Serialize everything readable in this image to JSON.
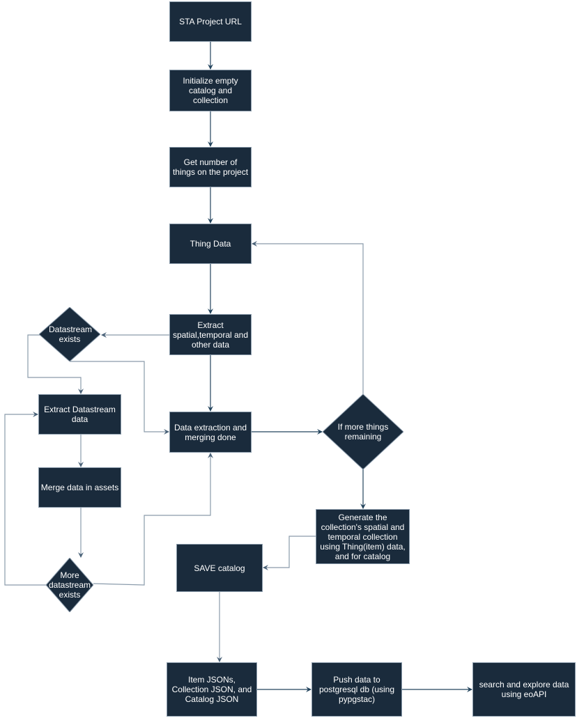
{
  "colors": {
    "node_fill": "#1a2b3c",
    "node_border": "#8a9bab",
    "edge_dark": "#23445d",
    "edge_grey": "#8a9bab",
    "text": "#ffffff"
  },
  "nodes": {
    "sta_url": "STA Project URL",
    "init": "Initialize empty catalog and collection",
    "get_number": "Get number of things on the project",
    "thing_data": "Thing Data",
    "extract_spatial": "Extract spatial,temporal and other data",
    "datastream_exists": "Datastream exists",
    "extract_datastream": "Extract Datastream data",
    "merge_assets": "Merge data in assets",
    "more_datastream": "More datastream exists",
    "extraction_done": "Data extraction and merging done",
    "more_things": "If more things remaining",
    "generate": "Generate the collection's spatial and temporal collection using Thing(item) data, and for catalog",
    "save_catalog": "SAVE catalog",
    "item_jsons": "Item JSONs, Collection JSON, and Catalog JSON",
    "push_data": "Push data to postgresql db (using pypgstac)",
    "search": "search and explore data using eoAPI"
  }
}
